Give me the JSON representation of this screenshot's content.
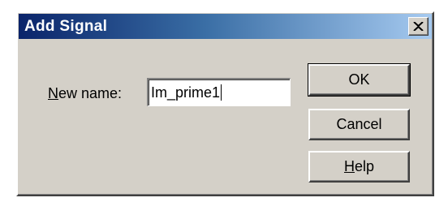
{
  "window": {
    "title": "Add Signal",
    "close_icon": "close-icon"
  },
  "form": {
    "name_label_accel": "N",
    "name_label_rest": "ew name:",
    "name_value": "Im_prime1"
  },
  "buttons": {
    "ok_label": "OK",
    "cancel_label": "Cancel",
    "help_accel": "H",
    "help_rest": "elp"
  },
  "colors": {
    "dialog_face": "#d4d0c8",
    "title_gradient_start": "#0a246a",
    "title_gradient_end": "#a6caf0",
    "title_text": "#ffffff"
  }
}
